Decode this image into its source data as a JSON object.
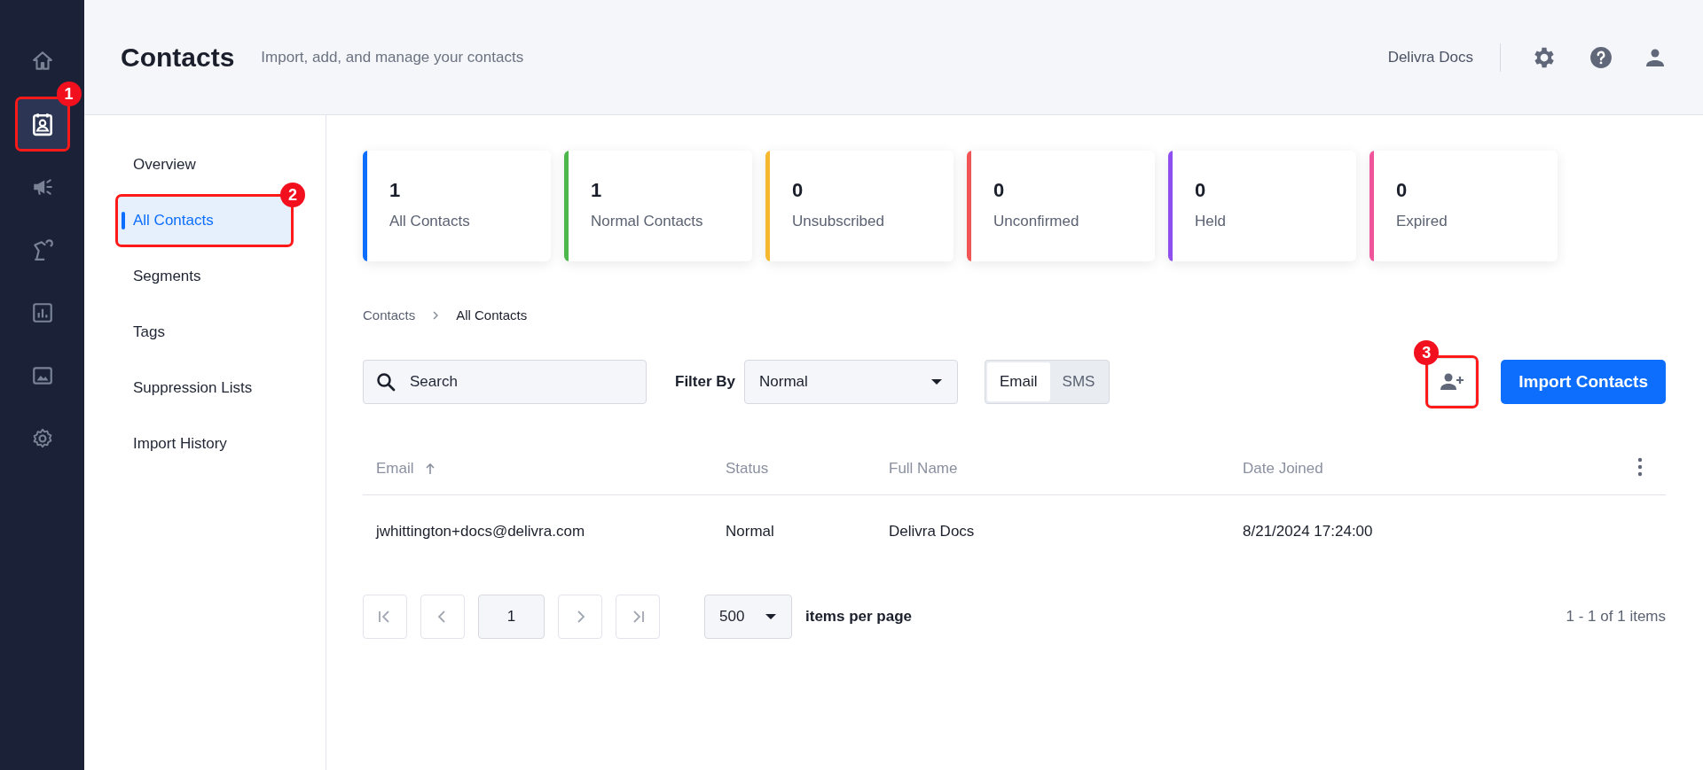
{
  "rail": {
    "items": [
      {
        "kind": "home",
        "selected": false
      },
      {
        "kind": "contacts",
        "selected": true,
        "callout": "1"
      },
      {
        "kind": "megaphone",
        "selected": false
      },
      {
        "kind": "robot",
        "selected": false
      },
      {
        "kind": "chart",
        "selected": false
      },
      {
        "kind": "image",
        "selected": false
      },
      {
        "kind": "gear",
        "selected": false
      }
    ]
  },
  "header": {
    "title": "Contacts",
    "subtitle": "Import, add, and manage your contacts",
    "account": "Delivra Docs"
  },
  "subnav": {
    "items": [
      {
        "label": "Overview",
        "selected": false
      },
      {
        "label": "All Contacts",
        "selected": true,
        "callout": "2"
      },
      {
        "label": "Segments",
        "selected": false
      },
      {
        "label": "Tags",
        "selected": false
      },
      {
        "label": "Suppression Lists",
        "selected": false
      },
      {
        "label": "Import History",
        "selected": false
      }
    ]
  },
  "stats": [
    {
      "value": "1",
      "label": "All Contacts",
      "color": "#0d6efd"
    },
    {
      "value": "1",
      "label": "Normal Contacts",
      "color": "#4cb84c"
    },
    {
      "value": "0",
      "label": "Unsubscribed",
      "color": "#f5b82e"
    },
    {
      "value": "0",
      "label": "Unconfirmed",
      "color": "#f25555"
    },
    {
      "value": "0",
      "label": "Held",
      "color": "#8f4ff0"
    },
    {
      "value": "0",
      "label": "Expired",
      "color": "#f0559c"
    }
  ],
  "breadcrumb": [
    "Contacts",
    "All Contacts"
  ],
  "toolbar": {
    "search": {
      "placeholder": "Search"
    },
    "filter_label": "Filter By",
    "filter_value": "Normal",
    "channels": [
      {
        "label": "Email",
        "selected": true
      },
      {
        "label": "SMS",
        "selected": false
      }
    ],
    "add_contact": {
      "callout": "3"
    },
    "import_button": "Import Contacts"
  },
  "table": {
    "columns": [
      {
        "label": "Email",
        "sorted": true
      },
      {
        "label": "Status",
        "sorted": false
      },
      {
        "label": "Full Name",
        "sorted": false
      },
      {
        "label": "Date Joined",
        "sorted": false
      }
    ],
    "rows": [
      [
        "jwhittington+docs@delivra.com",
        "Normal",
        "Delivra Docs",
        "8/21/2024 17:24:00"
      ]
    ]
  },
  "pagination": {
    "page": "1",
    "page_size": "500",
    "page_size_label": "items per page",
    "summary": "1 - 1 of 1 items"
  }
}
